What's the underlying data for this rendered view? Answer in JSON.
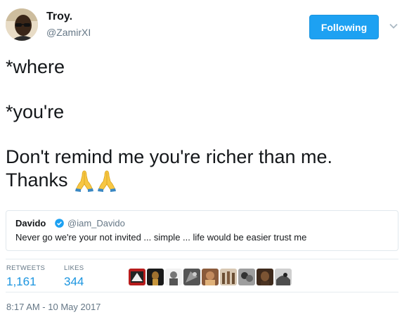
{
  "author": {
    "display_name": "Troy.",
    "screen_name": "@ZamirXI"
  },
  "follow_button": {
    "label": "Following",
    "color": "#1da1f2"
  },
  "tweet": {
    "lines": [
      "*where",
      "*you're",
      "Don't remind me you're richer than me.",
      "Thanks"
    ],
    "emoji": [
      "folded-hands",
      "folded-hands"
    ]
  },
  "quoted_tweet": {
    "display_name": "Davido",
    "verified": true,
    "screen_name": "@iam_Davido",
    "text": "Never go we're your not invited ... simple ... life would be easier trust me"
  },
  "stats": {
    "retweets_label": "RETWEETS",
    "retweets_value": "1,161",
    "likes_label": "LIKES",
    "likes_value": "344"
  },
  "liker_avatars": [
    "liker-avatar-1",
    "liker-avatar-2",
    "liker-avatar-3",
    "liker-avatar-4",
    "liker-avatar-5",
    "liker-avatar-6",
    "liker-avatar-7",
    "liker-avatar-8",
    "liker-avatar-9"
  ],
  "timestamp": "8:17 AM - 10 May 2017",
  "colors": {
    "link_blue": "#1b95e0",
    "muted_text": "#657786",
    "text": "#14171a",
    "border": "#e1e8ed"
  }
}
